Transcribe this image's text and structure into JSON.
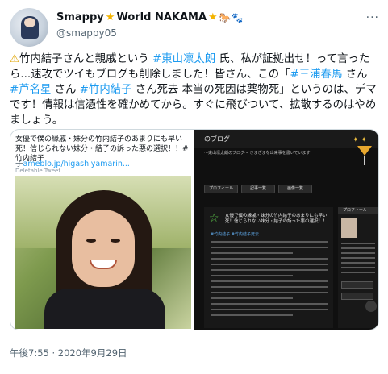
{
  "user": {
    "display_name_prefix": "Smappy",
    "display_name_middle": "World NAKAMA",
    "display_emoji": "🐎🐾",
    "handle": "@smappy05"
  },
  "tweet": {
    "warning_glyph": "⚠",
    "t1": "竹内結子さんと親戚という ",
    "h1": "#東山凛太朗",
    "t2": " 氏、私が証拠出せ！って言ったら...速攻でツイもブログも削除しました！皆さん、この「",
    "h2": "#三浦春馬",
    "t3": " さん ",
    "h3": "#芦名星",
    "t4": " さん ",
    "h4": "#竹内結子",
    "t5": " さん死去 本当の死因は薬物死」というのは、デマです！情報は信憑性を確かめてから。すぐに飛びついて、拡散するのはやめましょう。"
  },
  "card_left": {
    "title": "女優で僕の縁戚・妹分の竹内結子のあまりにも早い死！信じられない妹分・結子の訴った悪の選択！！#竹内結子",
    "link_lead": "子",
    "link": "ameblo.jp/higashiyamarin...",
    "sub": "Deletable Tweet"
  },
  "card_right": {
    "blog_title": "のブログ",
    "tagline": "〜東山凛太朗のブログ〜 さまざまな出来事を書いています",
    "nav": [
      "プロフィール",
      "記事一覧",
      "画像一覧"
    ],
    "post_title": "女優で僕の縁戚・妹分の竹内結子のあまりにも早い死！信じられない妹分・結子の訴った悪の選択！！",
    "post_link": "#竹内結子 #竹内結子死去",
    "profile_header": "プロフィール"
  },
  "timestamp": "午後7:55 · 2020年9月29日",
  "colors": {
    "hashtag": "#1d9bf0",
    "text": "#0f1419",
    "muted": "#536471"
  }
}
